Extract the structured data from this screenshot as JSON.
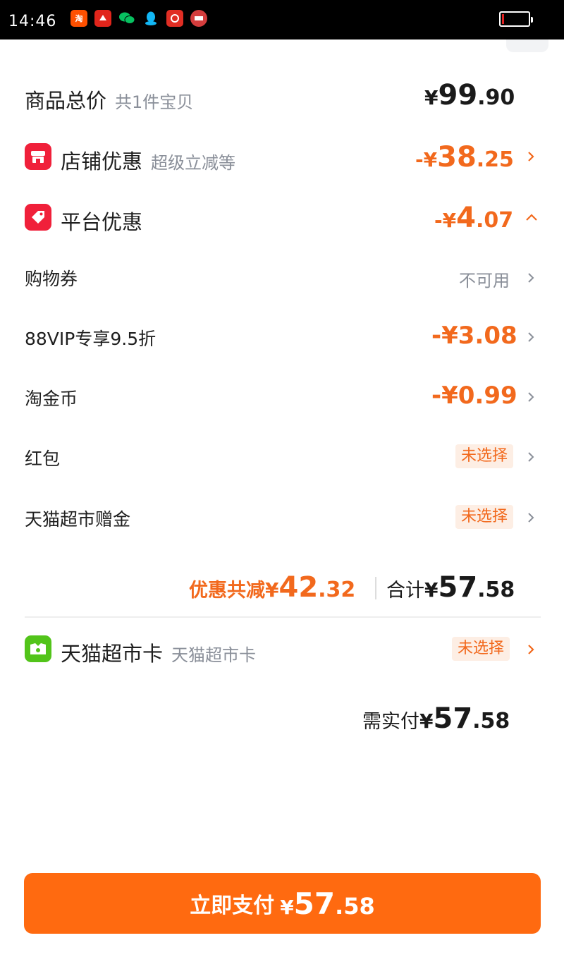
{
  "status_bar": {
    "time": "14:46",
    "notification_icons": [
      {
        "name": "taobao-icon",
        "glyph": "淘",
        "color": "#ff5000"
      },
      {
        "name": "jd-icon",
        "glyph": "",
        "color": "#e1251b"
      },
      {
        "name": "wechat-icon",
        "glyph": "",
        "color": "#07c160"
      },
      {
        "name": "qq-icon",
        "glyph": "",
        "color": "#12b7f5"
      },
      {
        "name": "pinduoduo-icon",
        "glyph": "",
        "color": "#e02e24"
      },
      {
        "name": "toutiao-icon",
        "glyph": "",
        "color": "#d43d3d"
      }
    ]
  },
  "summary": {
    "total": {
      "label": "商品总价",
      "sub": "共1件宝贝",
      "cur": "¥",
      "int": "99",
      "dec": ".90"
    },
    "shop_discount": {
      "label": "店铺优惠",
      "sub": "超级立减等",
      "cur": "-¥",
      "int": "38",
      "dec": ".25"
    },
    "platform_discount": {
      "label": "平台优惠",
      "cur": "-¥",
      "int": "4",
      "dec": ".07"
    }
  },
  "platform_items": [
    {
      "label": "购物券",
      "value": "不可用",
      "style": "grey"
    },
    {
      "label": "88VIP专享9.5折",
      "value": "-¥3.08",
      "style": "orange"
    },
    {
      "label": "淘金币",
      "value": "-¥0.99",
      "style": "orange"
    },
    {
      "label": "红包",
      "value": "未选择",
      "style": "pill"
    },
    {
      "label": "天猫超市赠金",
      "value": "未选择",
      "style": "pill"
    }
  ],
  "totals": {
    "discount_label": "优惠共减",
    "discount_cur": "¥",
    "discount_int": "42",
    "discount_dec": ".32",
    "total_label": "合计",
    "total_cur": "¥",
    "total_int": "57",
    "total_dec": ".58"
  },
  "tmall_card": {
    "label": "天猫超市卡",
    "sub": "天猫超市卡",
    "value": "未选择"
  },
  "payable": {
    "label": "需实付",
    "cur": "¥",
    "int": "57",
    "dec": ".58"
  },
  "pay_button": {
    "label": "立即支付",
    "cur": "¥",
    "int": "57",
    "dec": ".58"
  },
  "colors": {
    "accent": "#f2691d",
    "button": "#ff6a10",
    "shop_icon": "#f0203a",
    "card_icon": "#52c41a"
  }
}
